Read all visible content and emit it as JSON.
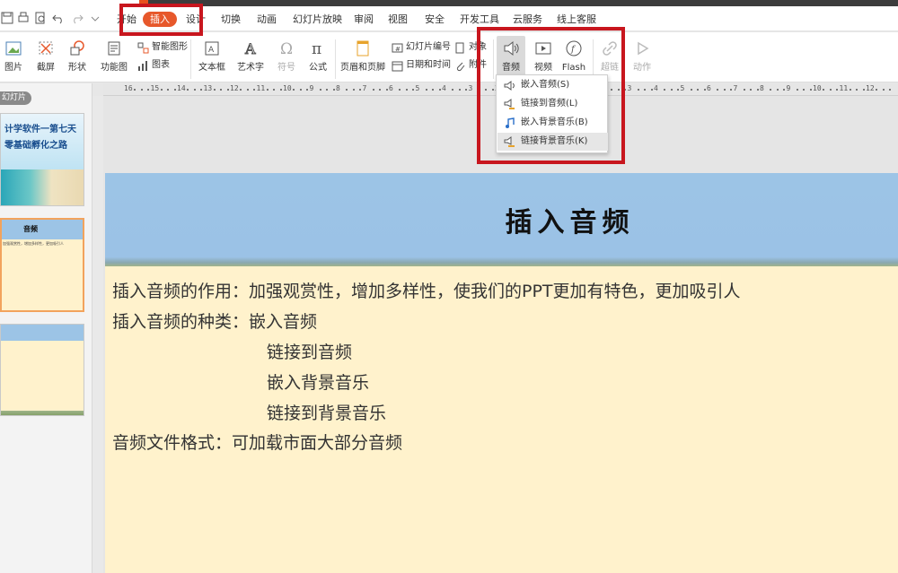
{
  "ribbon_tabs": [
    "开始",
    "插入",
    "设计",
    "切换",
    "动画",
    "幻灯片放映",
    "审阅",
    "视图",
    "安全",
    "开发工具",
    "云服务",
    "线上客服"
  ],
  "active_tab": "插入",
  "ribbon": {
    "picture": "图片",
    "screenshot": "截屏",
    "shape": "形状",
    "function_chart": "功能图",
    "smart_shape": "智能图形",
    "chart": "图表",
    "textbox": "文本框",
    "art_text": "艺术字",
    "symbol": "符号",
    "formula": "公式",
    "header_footer": "页眉和页脚",
    "slide_number": "幻灯片编号",
    "object": "对象",
    "date_time": "日期和时间",
    "attachment": "附件",
    "audio": "音频",
    "video": "视频",
    "flash": "Flash",
    "hyperlink": "超链",
    "action": "动作"
  },
  "audio_menu": [
    "嵌入音频(S)",
    "链接到音频(L)",
    "嵌入背景音乐(B)",
    "链接背景音乐(K)"
  ],
  "left_panel": {
    "label": "幻灯片",
    "thumb1_line1": "计学软件一第七天",
    "thumb1_line2": "零基础孵化之路",
    "thumb2_title": "音频",
    "thumb2_text": "加强观赏性，增加多样性，更加吸引人"
  },
  "ruler_numbers": [
    "16",
    "15",
    "14",
    "13",
    "12",
    "11",
    "10",
    "9",
    "8",
    "7",
    "6",
    "5",
    "4",
    "3",
    "2",
    "1",
    "0",
    "1",
    "2",
    "3",
    "4",
    "5",
    "6",
    "7",
    "8",
    "9",
    "10",
    "11",
    "12",
    "13",
    "14",
    "15",
    "16"
  ],
  "slide": {
    "title": "插入音频",
    "line1": "插入音频的作用：加强观赏性，增加多样性，使我们的PPT更加有特色，更加吸引人",
    "line2": "插入音频的种类：嵌入音频",
    "line3": "链接到音频",
    "line4": "嵌入背景音乐",
    "line5": "链接到背景音乐",
    "line6": "音频文件格式：可加载市面大部分音频"
  },
  "colors": {
    "accent": "#e7582b",
    "annotation_red": "#c8161e",
    "slide_header": "#9cc4e6",
    "slide_body": "#fff2cc"
  }
}
